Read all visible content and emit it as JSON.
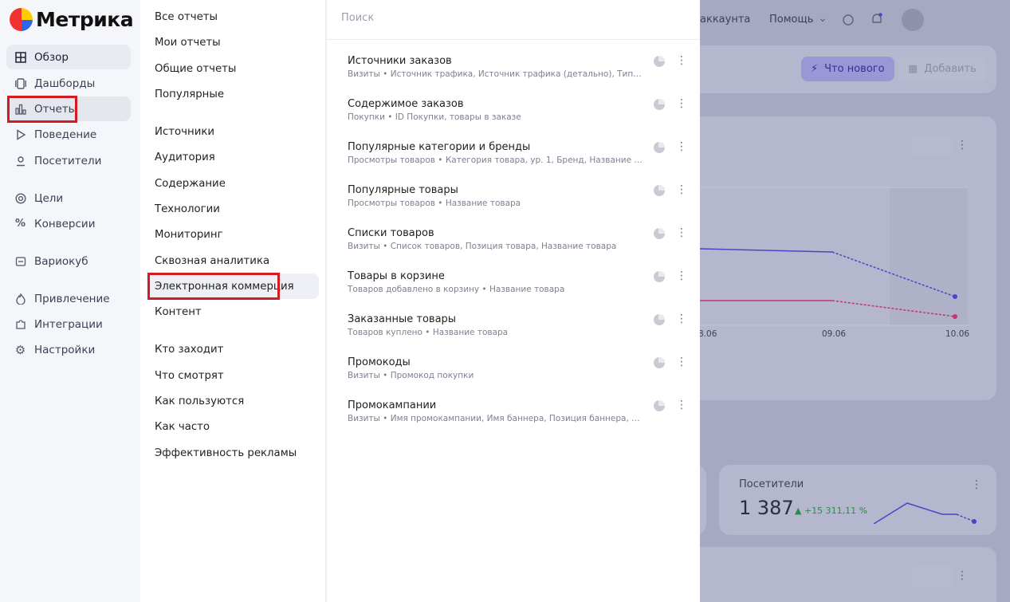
{
  "app": {
    "logo_text": "Метрика"
  },
  "sidebar": {
    "items": [
      {
        "label": "Обзор",
        "icon": "grid-icon"
      },
      {
        "label": "Дашборды",
        "icon": "dashboards-icon"
      },
      {
        "label": "Отчеты",
        "icon": "bar-chart-icon"
      },
      {
        "label": "Поведение",
        "icon": "play-icon"
      },
      {
        "label": "Посетители",
        "icon": "user-icon"
      },
      {
        "label": "Цели",
        "icon": "target-icon"
      },
      {
        "label": "Конверсии",
        "icon": "percent-icon"
      },
      {
        "label": "Вариокуб",
        "icon": "cube-icon"
      },
      {
        "label": "Привлечение",
        "icon": "fire-icon"
      },
      {
        "label": "Интеграции",
        "icon": "puzzle-icon"
      },
      {
        "label": "Настройки",
        "icon": "gear-icon"
      }
    ]
  },
  "categories": {
    "items": [
      "Все отчеты",
      "Мои отчеты",
      "Общие отчеты",
      "Популярные",
      "Источники",
      "Аудитория",
      "Содержание",
      "Технологии",
      "Мониторинг",
      "Сквозная аналитика",
      "Электронная коммерция",
      "Контент",
      "Кто заходит",
      "Что смотрят",
      "Как пользуются",
      "Как часто",
      "Эффективность рекламы"
    ],
    "selected": "Электронная коммерция"
  },
  "search": {
    "placeholder": "Поиск"
  },
  "reports": [
    {
      "title": "Источники заказов",
      "subtitle": "Визиты • Источник трафика, Источник трафика (детально), Тип площадки"
    },
    {
      "title": "Содержимое заказов",
      "subtitle": "Покупки • ID Покупки, товары в заказе"
    },
    {
      "title": "Популярные категории и бренды",
      "subtitle": "Просмотры товаров • Категория товара, ур. 1, Бренд, Название товара"
    },
    {
      "title": "Популярные товары",
      "subtitle": "Просмотры товаров • Название товара"
    },
    {
      "title": "Списки товаров",
      "subtitle": "Визиты • Список товаров, Позиция товара, Название товара"
    },
    {
      "title": "Товары в корзине",
      "subtitle": "Товаров добавлено в корзину • Название товара"
    },
    {
      "title": "Заказанные товары",
      "subtitle": "Товаров куплено • Название товара"
    },
    {
      "title": "Промокоды",
      "subtitle": "Визиты • Промокод покупки"
    },
    {
      "title": "Промокампании",
      "subtitle": "Визиты • Имя промокампании, Имя баннера, Позиция баннера, Располо..."
    }
  ],
  "background": {
    "header": {
      "account_fragment": "аккаунта",
      "help": "Помощь"
    },
    "buttons": {
      "whats_new": "Что нового",
      "add": "Добавить"
    },
    "chart_ticks": [
      "8.06",
      "09.06",
      "10.06"
    ],
    "visitors_card": {
      "title": "Посетители",
      "value": "1 387",
      "delta": "▲ +15 311,11 %"
    }
  },
  "colors": {
    "accent": "#d21c21",
    "series_blue": "#4a45c8",
    "series_pink": "#c2356f",
    "delta_green": "#2e8a4a"
  }
}
